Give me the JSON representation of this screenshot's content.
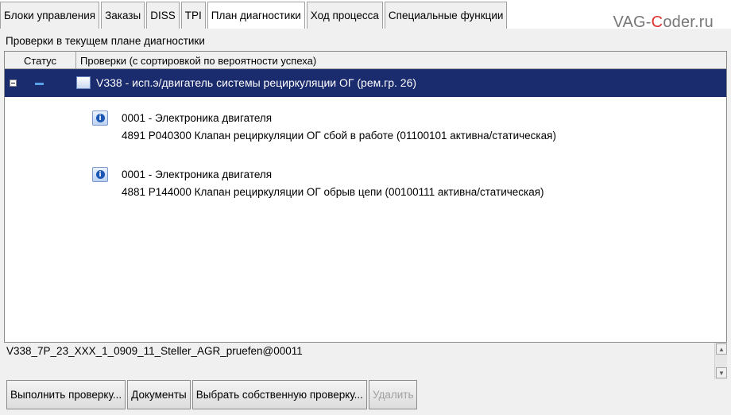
{
  "tabs": [
    {
      "label": "Блоки управления",
      "active": false
    },
    {
      "label": "Заказы",
      "active": false
    },
    {
      "label": "DISS",
      "active": false
    },
    {
      "label": "TPI",
      "active": false
    },
    {
      "label": "План диагностики",
      "active": true
    },
    {
      "label": "Ход процесса",
      "active": false
    },
    {
      "label": "Специальные функции",
      "active": false
    }
  ],
  "watermark": {
    "part1": "VAG-",
    "accent": "C",
    "part2": "oder.ru"
  },
  "pane": {
    "title": "Проверки в текущем плане диагностики"
  },
  "grid": {
    "headers": {
      "status": "Статус",
      "checks": "Проверки (с сортировкой по вероятности успеха)"
    },
    "selected_row": {
      "label": "V338 - исп.э/двигатель системы рециркуляции ОГ (рем.гр. 26)"
    },
    "entries": [
      {
        "line1": "0001 - Электроника двигателя",
        "line2": "4891   P040300   Клапан рециркуляции ОГ сбой в работе  (01100101   активна/статическая)"
      },
      {
        "line1": "0001 - Электроника двигателя",
        "line2": "4881   P144000   Клапан рециркуляции ОГ обрыв цепи  (00100111   активна/статическая)"
      }
    ]
  },
  "infoline": {
    "text": "V338_7P_23_XXX_1_0909_11_Steller_AGR_pruefen@00011"
  },
  "buttons": {
    "run": "Выполнить проверку...",
    "documents": "Документы",
    "choose": "Выбрать собственную проверку...",
    "delete": "Удалить"
  },
  "colors": {
    "selection": "#1a2b6e",
    "status_dash": "#5aa0e8",
    "watermark_accent": "#e03030"
  }
}
